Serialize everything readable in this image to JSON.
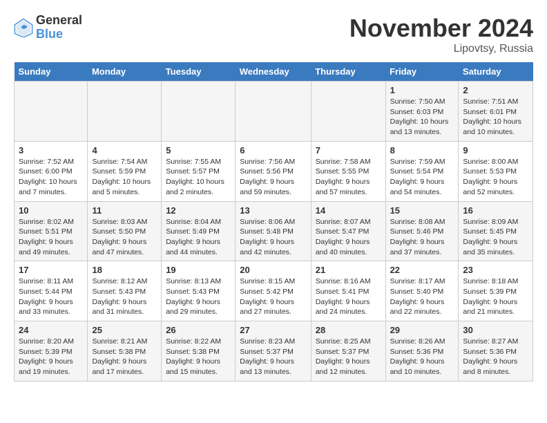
{
  "logo": {
    "line1": "General",
    "line2": "Blue"
  },
  "title": "November 2024",
  "location": "Lipovtsy, Russia",
  "days_of_week": [
    "Sunday",
    "Monday",
    "Tuesday",
    "Wednesday",
    "Thursday",
    "Friday",
    "Saturday"
  ],
  "weeks": [
    [
      {
        "day": "",
        "sunrise": "",
        "sunset": "",
        "daylight": ""
      },
      {
        "day": "",
        "sunrise": "",
        "sunset": "",
        "daylight": ""
      },
      {
        "day": "",
        "sunrise": "",
        "sunset": "",
        "daylight": ""
      },
      {
        "day": "",
        "sunrise": "",
        "sunset": "",
        "daylight": ""
      },
      {
        "day": "",
        "sunrise": "",
        "sunset": "",
        "daylight": ""
      },
      {
        "day": "1",
        "sunrise": "Sunrise: 7:50 AM",
        "sunset": "Sunset: 6:03 PM",
        "daylight": "Daylight: 10 hours and 13 minutes."
      },
      {
        "day": "2",
        "sunrise": "Sunrise: 7:51 AM",
        "sunset": "Sunset: 6:01 PM",
        "daylight": "Daylight: 10 hours and 10 minutes."
      }
    ],
    [
      {
        "day": "3",
        "sunrise": "Sunrise: 7:52 AM",
        "sunset": "Sunset: 6:00 PM",
        "daylight": "Daylight: 10 hours and 7 minutes."
      },
      {
        "day": "4",
        "sunrise": "Sunrise: 7:54 AM",
        "sunset": "Sunset: 5:59 PM",
        "daylight": "Daylight: 10 hours and 5 minutes."
      },
      {
        "day": "5",
        "sunrise": "Sunrise: 7:55 AM",
        "sunset": "Sunset: 5:57 PM",
        "daylight": "Daylight: 10 hours and 2 minutes."
      },
      {
        "day": "6",
        "sunrise": "Sunrise: 7:56 AM",
        "sunset": "Sunset: 5:56 PM",
        "daylight": "Daylight: 9 hours and 59 minutes."
      },
      {
        "day": "7",
        "sunrise": "Sunrise: 7:58 AM",
        "sunset": "Sunset: 5:55 PM",
        "daylight": "Daylight: 9 hours and 57 minutes."
      },
      {
        "day": "8",
        "sunrise": "Sunrise: 7:59 AM",
        "sunset": "Sunset: 5:54 PM",
        "daylight": "Daylight: 9 hours and 54 minutes."
      },
      {
        "day": "9",
        "sunrise": "Sunrise: 8:00 AM",
        "sunset": "Sunset: 5:53 PM",
        "daylight": "Daylight: 9 hours and 52 minutes."
      }
    ],
    [
      {
        "day": "10",
        "sunrise": "Sunrise: 8:02 AM",
        "sunset": "Sunset: 5:51 PM",
        "daylight": "Daylight: 9 hours and 49 minutes."
      },
      {
        "day": "11",
        "sunrise": "Sunrise: 8:03 AM",
        "sunset": "Sunset: 5:50 PM",
        "daylight": "Daylight: 9 hours and 47 minutes."
      },
      {
        "day": "12",
        "sunrise": "Sunrise: 8:04 AM",
        "sunset": "Sunset: 5:49 PM",
        "daylight": "Daylight: 9 hours and 44 minutes."
      },
      {
        "day": "13",
        "sunrise": "Sunrise: 8:06 AM",
        "sunset": "Sunset: 5:48 PM",
        "daylight": "Daylight: 9 hours and 42 minutes."
      },
      {
        "day": "14",
        "sunrise": "Sunrise: 8:07 AM",
        "sunset": "Sunset: 5:47 PM",
        "daylight": "Daylight: 9 hours and 40 minutes."
      },
      {
        "day": "15",
        "sunrise": "Sunrise: 8:08 AM",
        "sunset": "Sunset: 5:46 PM",
        "daylight": "Daylight: 9 hours and 37 minutes."
      },
      {
        "day": "16",
        "sunrise": "Sunrise: 8:09 AM",
        "sunset": "Sunset: 5:45 PM",
        "daylight": "Daylight: 9 hours and 35 minutes."
      }
    ],
    [
      {
        "day": "17",
        "sunrise": "Sunrise: 8:11 AM",
        "sunset": "Sunset: 5:44 PM",
        "daylight": "Daylight: 9 hours and 33 minutes."
      },
      {
        "day": "18",
        "sunrise": "Sunrise: 8:12 AM",
        "sunset": "Sunset: 5:43 PM",
        "daylight": "Daylight: 9 hours and 31 minutes."
      },
      {
        "day": "19",
        "sunrise": "Sunrise: 8:13 AM",
        "sunset": "Sunset: 5:43 PM",
        "daylight": "Daylight: 9 hours and 29 minutes."
      },
      {
        "day": "20",
        "sunrise": "Sunrise: 8:15 AM",
        "sunset": "Sunset: 5:42 PM",
        "daylight": "Daylight: 9 hours and 27 minutes."
      },
      {
        "day": "21",
        "sunrise": "Sunrise: 8:16 AM",
        "sunset": "Sunset: 5:41 PM",
        "daylight": "Daylight: 9 hours and 24 minutes."
      },
      {
        "day": "22",
        "sunrise": "Sunrise: 8:17 AM",
        "sunset": "Sunset: 5:40 PM",
        "daylight": "Daylight: 9 hours and 22 minutes."
      },
      {
        "day": "23",
        "sunrise": "Sunrise: 8:18 AM",
        "sunset": "Sunset: 5:39 PM",
        "daylight": "Daylight: 9 hours and 21 minutes."
      }
    ],
    [
      {
        "day": "24",
        "sunrise": "Sunrise: 8:20 AM",
        "sunset": "Sunset: 5:39 PM",
        "daylight": "Daylight: 9 hours and 19 minutes."
      },
      {
        "day": "25",
        "sunrise": "Sunrise: 8:21 AM",
        "sunset": "Sunset: 5:38 PM",
        "daylight": "Daylight: 9 hours and 17 minutes."
      },
      {
        "day": "26",
        "sunrise": "Sunrise: 8:22 AM",
        "sunset": "Sunset: 5:38 PM",
        "daylight": "Daylight: 9 hours and 15 minutes."
      },
      {
        "day": "27",
        "sunrise": "Sunrise: 8:23 AM",
        "sunset": "Sunset: 5:37 PM",
        "daylight": "Daylight: 9 hours and 13 minutes."
      },
      {
        "day": "28",
        "sunrise": "Sunrise: 8:25 AM",
        "sunset": "Sunset: 5:37 PM",
        "daylight": "Daylight: 9 hours and 12 minutes."
      },
      {
        "day": "29",
        "sunrise": "Sunrise: 8:26 AM",
        "sunset": "Sunset: 5:36 PM",
        "daylight": "Daylight: 9 hours and 10 minutes."
      },
      {
        "day": "30",
        "sunrise": "Sunrise: 8:27 AM",
        "sunset": "Sunset: 5:36 PM",
        "daylight": "Daylight: 9 hours and 8 minutes."
      }
    ]
  ]
}
